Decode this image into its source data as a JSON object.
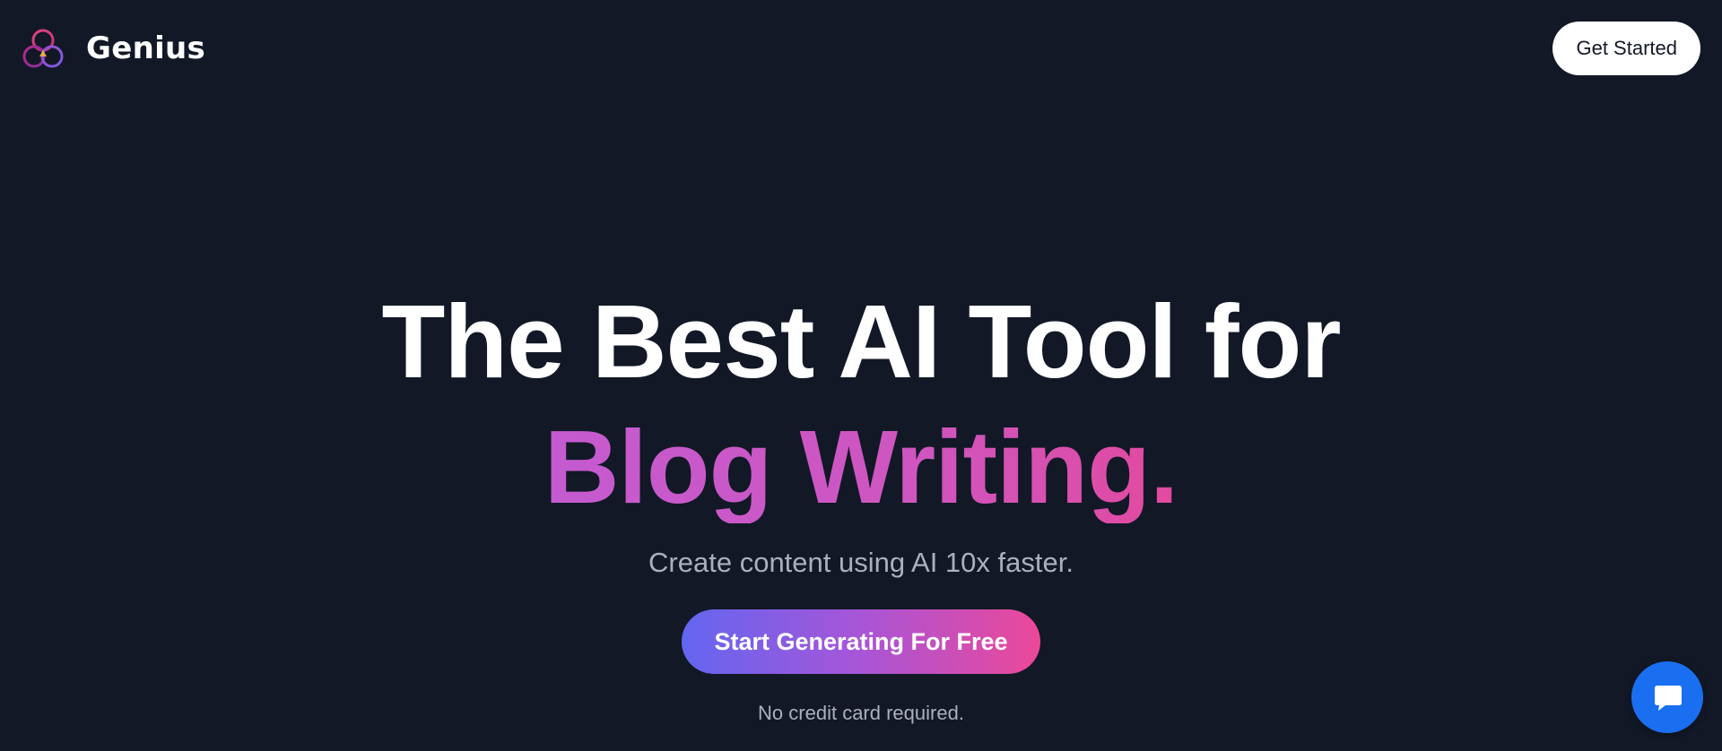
{
  "header": {
    "brand_name": "Genius",
    "logo_icon": "three-rings-logo-icon",
    "get_started_label": "Get Started"
  },
  "hero": {
    "headline_line1": "The Best AI Tool for",
    "headline_line2": "Blog Writing.",
    "subtitle": "Create content using AI 10x faster.",
    "cta_label": "Start Generating For Free",
    "note": "No credit card required."
  },
  "chat": {
    "icon": "chat-bubble-icon"
  },
  "colors": {
    "background": "#121826",
    "accent_gradient_start": "#6366f1",
    "accent_gradient_mid": "#a855d7",
    "accent_gradient_end": "#ec4899",
    "headline_highlight": "#c856c3",
    "chat_button": "#1a6ff0"
  }
}
